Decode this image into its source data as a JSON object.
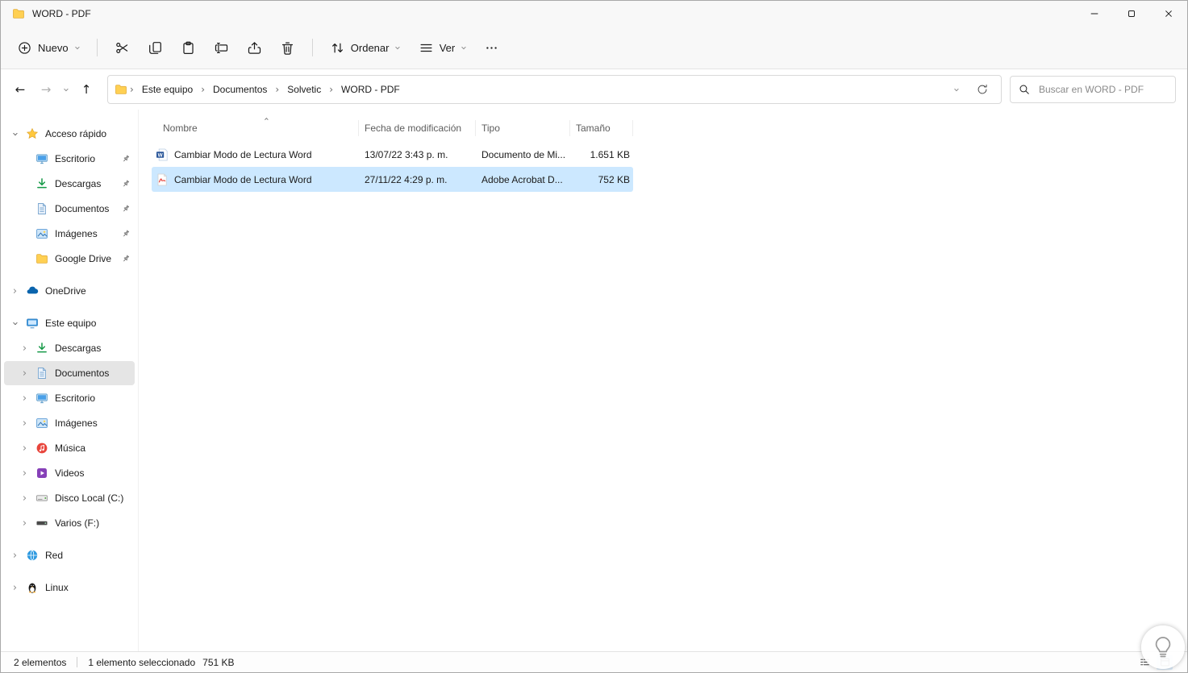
{
  "colors": {
    "accent": "#0078d4",
    "selection_bg": "#cce8ff",
    "sidebar_selected_bg": "#e5e5e5"
  },
  "window": {
    "title": "WORD - PDF"
  },
  "toolbar": {
    "nuevo_label": "Nuevo",
    "ordenar_label": "Ordenar",
    "ver_label": "Ver"
  },
  "navbar": {
    "breadcrumbs": [
      {
        "label": "Este equipo"
      },
      {
        "label": "Documentos"
      },
      {
        "label": "Solvetic"
      },
      {
        "label": "WORD - PDF"
      }
    ],
    "search_placeholder": "Buscar en WORD - PDF"
  },
  "sidebar": {
    "items": [
      {
        "label": "Acceso rápido",
        "icon": "star",
        "expanded": true
      },
      {
        "label": "Escritorio",
        "icon": "desktop",
        "pinned": true
      },
      {
        "label": "Descargas",
        "icon": "downloads",
        "pinned": true
      },
      {
        "label": "Documentos",
        "icon": "documents",
        "pinned": true
      },
      {
        "label": "Imágenes",
        "icon": "pictures",
        "pinned": true
      },
      {
        "label": "Google Drive",
        "icon": "folder",
        "pinned": true
      },
      {
        "label": "OneDrive",
        "icon": "onedrive-cloud",
        "expanded": false
      },
      {
        "label": "Este equipo",
        "icon": "computer",
        "expanded": true
      },
      {
        "label": "Descargas",
        "icon": "downloads",
        "expanded": false
      },
      {
        "label": "Documentos",
        "icon": "documents",
        "expanded": false,
        "selected": true
      },
      {
        "label": "Escritorio",
        "icon": "desktop",
        "expanded": false
      },
      {
        "label": "Imágenes",
        "icon": "pictures",
        "expanded": false
      },
      {
        "label": "Música",
        "icon": "music",
        "expanded": false
      },
      {
        "label": "Videos",
        "icon": "videos",
        "expanded": false
      },
      {
        "label": "Disco Local (C:)",
        "icon": "local-disk",
        "expanded": false
      },
      {
        "label": "Varios (F:)",
        "icon": "drive",
        "expanded": false
      },
      {
        "label": "Red",
        "icon": "network",
        "expanded": false
      },
      {
        "label": "Linux",
        "icon": "linux",
        "expanded": false
      }
    ]
  },
  "files": {
    "columns": {
      "name": "Nombre",
      "date": "Fecha de modificación",
      "type": "Tipo",
      "size": "Tamaño"
    },
    "rows": [
      {
        "name": "Cambiar Modo de Lectura Word",
        "date": "13/07/22 3:43 p. m.",
        "type": "Documento de Mi...",
        "size": "1.651 KB",
        "icon": "word-document",
        "selected": false
      },
      {
        "name": "Cambiar Modo de Lectura Word",
        "date": "27/11/22 4:29 p. m.",
        "type": "Adobe Acrobat D...",
        "size": "752 KB",
        "icon": "pdf-document",
        "selected": true
      }
    ]
  },
  "statusbar": {
    "count": "2 elementos",
    "selection": "1 elemento seleccionado",
    "selection_size": "751 KB"
  }
}
